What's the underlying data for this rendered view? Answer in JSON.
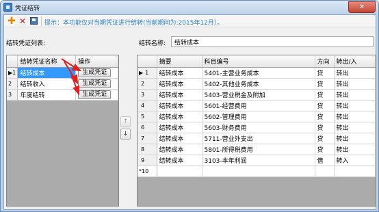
{
  "window": {
    "title": "凭证结转",
    "close_glyph": "✕"
  },
  "toolbar": {
    "add_icon": "plus-icon",
    "delete_icon": "delete-icon",
    "save_icon": "save-icon",
    "hint": "提示：本功能仅对当期凭证进行结转(当前期间为:2015年12月）。"
  },
  "left": {
    "list_label": "结转凭证列表:",
    "columns": [
      "结转凭证名称",
      "操作"
    ],
    "rows": [
      {
        "num": "1",
        "marker": "▶",
        "name": "结转成本",
        "action": "生成凭证",
        "selected": true
      },
      {
        "num": "2",
        "marker": "",
        "name": "结转收入",
        "action": "生成凭证",
        "selected": false
      },
      {
        "num": "3",
        "marker": "",
        "name": "年度结转",
        "action": "生成凭证",
        "selected": false
      }
    ]
  },
  "move": {
    "up": "↑",
    "down": "↓"
  },
  "right": {
    "name_label": "结转名称:",
    "name_value": "结转成本",
    "columns": [
      "摘要",
      "科目编号",
      "方向",
      "转出/入"
    ],
    "rows": [
      {
        "num": "1",
        "marker": "▶",
        "summary": "结转成本",
        "account": "5401-主营业务成本",
        "dir": "贷",
        "io": "转出"
      },
      {
        "num": "2",
        "marker": "",
        "summary": "结转成本",
        "account": "5402-其他业务成本",
        "dir": "贷",
        "io": "转出"
      },
      {
        "num": "3",
        "marker": "",
        "summary": "结转成本",
        "account": "5403-营业税金及附加",
        "dir": "贷",
        "io": "转出"
      },
      {
        "num": "4",
        "marker": "",
        "summary": "结转成本",
        "account": "5601-经营费用",
        "dir": "贷",
        "io": "转出"
      },
      {
        "num": "5",
        "marker": "",
        "summary": "结转成本",
        "account": "5602-管理费用",
        "dir": "贷",
        "io": "转出"
      },
      {
        "num": "6",
        "marker": "",
        "summary": "结转成本",
        "account": "5603-财务费用",
        "dir": "贷",
        "io": "转出"
      },
      {
        "num": "7",
        "marker": "",
        "summary": "结转成本",
        "account": "5711-营业外支出",
        "dir": "贷",
        "io": "转出"
      },
      {
        "num": "8",
        "marker": "",
        "summary": "结转成本",
        "account": "5801-所得税费用",
        "dir": "贷",
        "io": "转出"
      },
      {
        "num": "9",
        "marker": "",
        "summary": "结转成本",
        "account": "3103-本年利润",
        "dir": "借",
        "io": "转入"
      }
    ],
    "new_row": {
      "num": "10",
      "marker": "*"
    }
  },
  "colors": {
    "selection": "#3399ff",
    "hint": "#2a7fcf",
    "annotation": "#e02020"
  }
}
